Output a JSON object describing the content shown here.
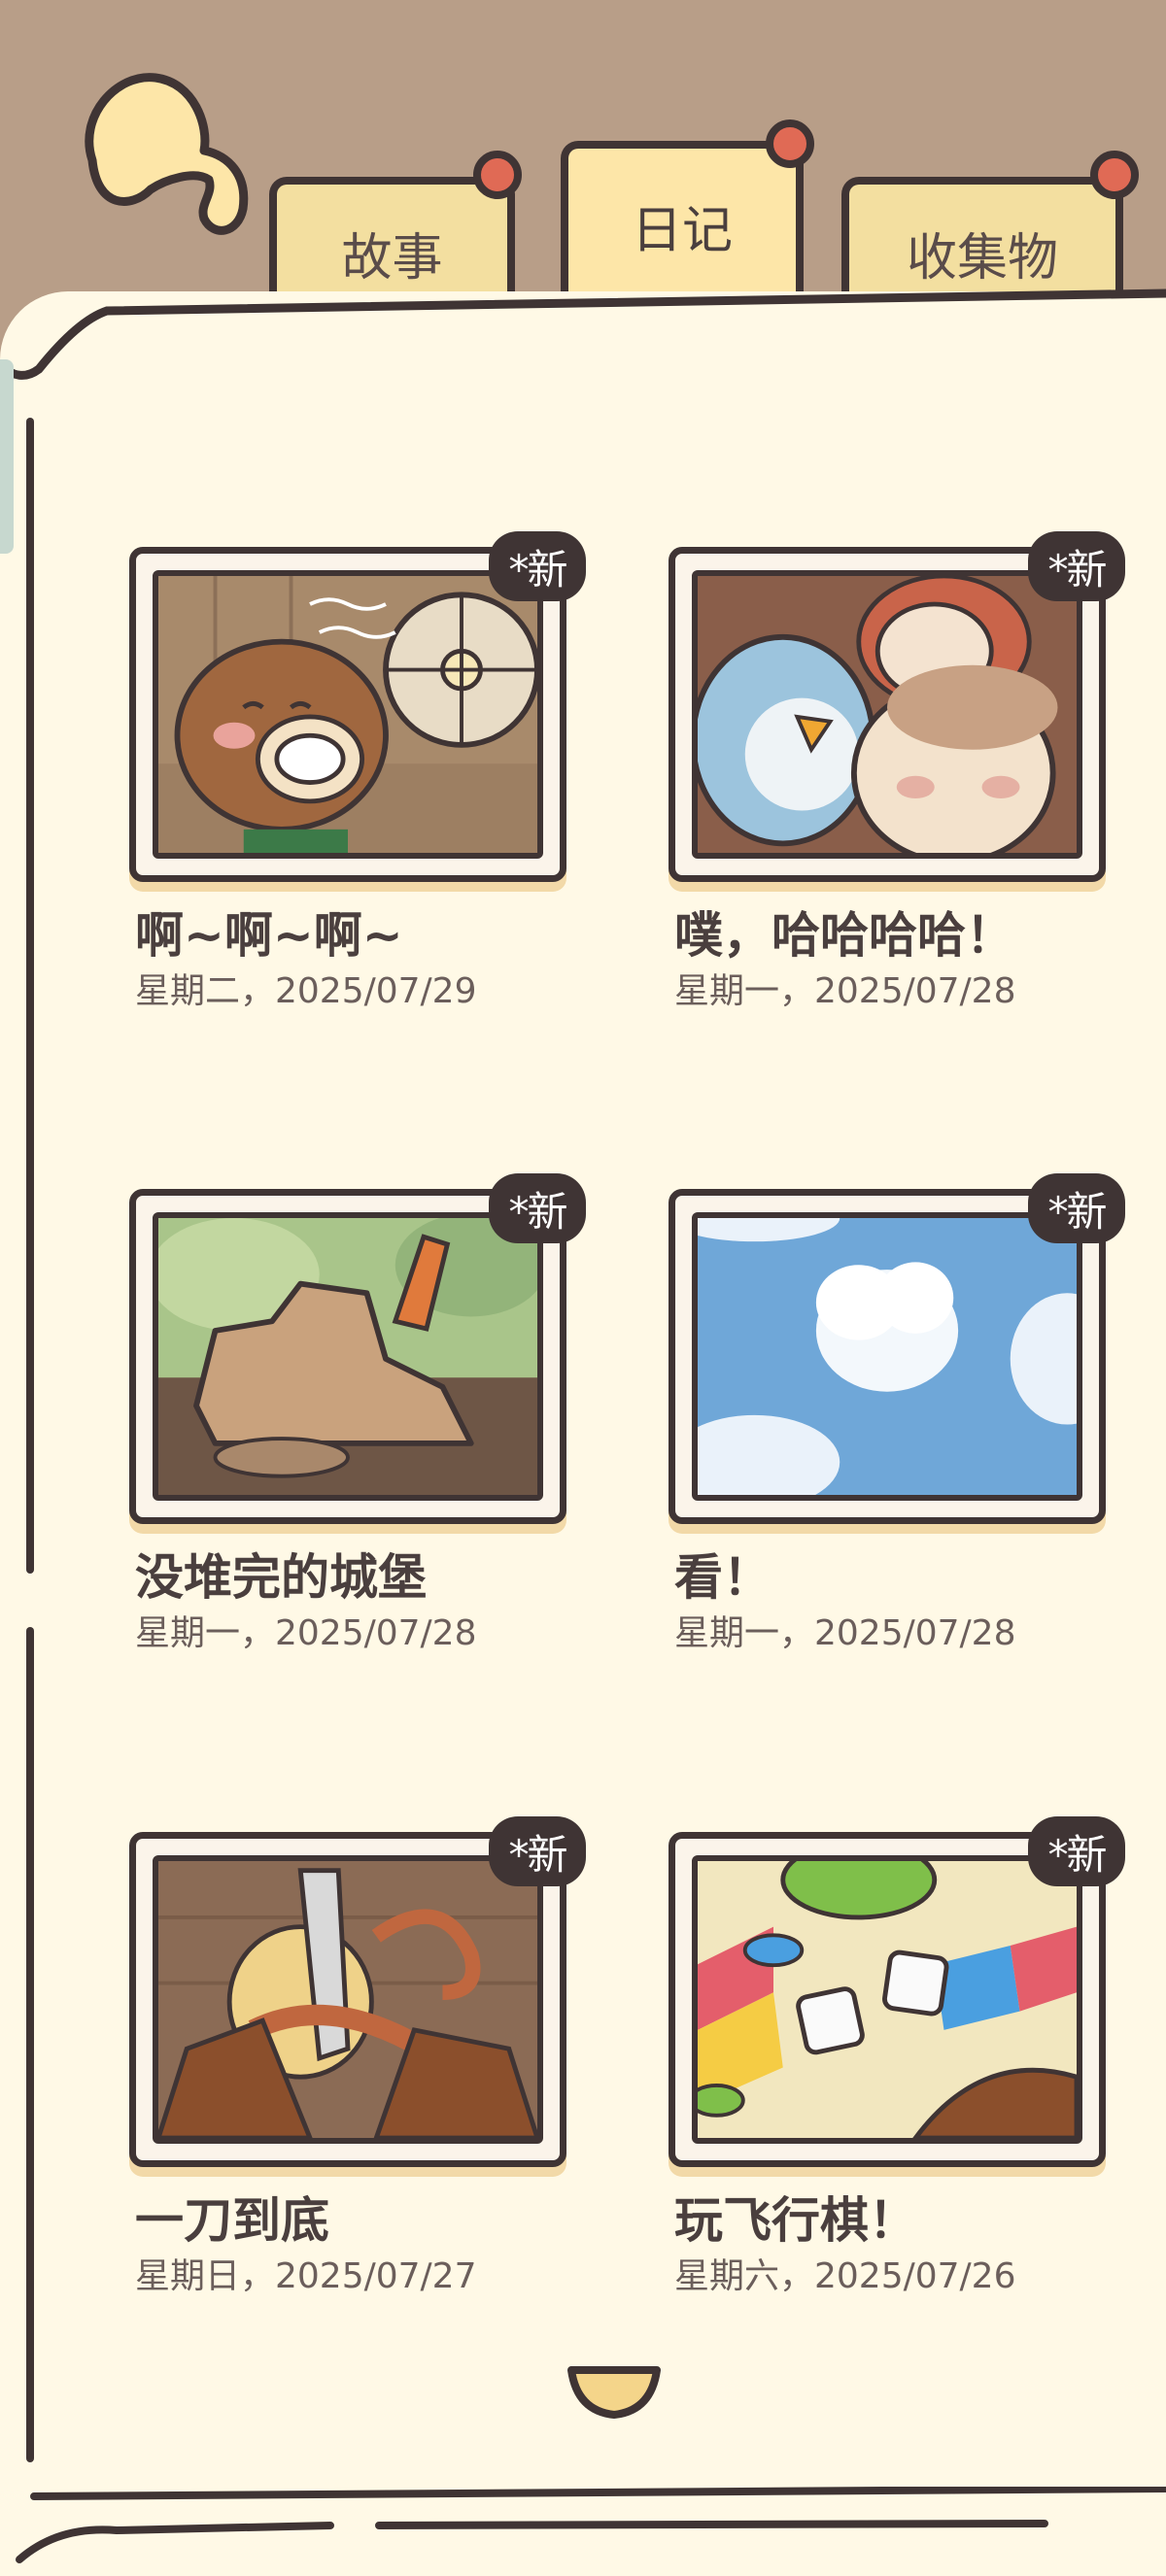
{
  "tabs": [
    {
      "label": "故事",
      "active": false
    },
    {
      "label": "日记",
      "active": true
    },
    {
      "label": "收集物",
      "active": false
    }
  ],
  "diary": [
    {
      "title": "啊~啊~啊~",
      "date": "星期二，2025/07/29",
      "badge": "*新",
      "image": "chipmunk-fan"
    },
    {
      "title": "噗，哈哈哈哈！",
      "date": "星期一，2025/07/28",
      "badge": "*新",
      "image": "friends-group"
    },
    {
      "title": "没堆完的城堡",
      "date": "星期一，2025/07/28",
      "badge": "*新",
      "image": "sand-castle"
    },
    {
      "title": "看！",
      "date": "星期一，2025/07/28",
      "badge": "*新",
      "image": "sky-cloud"
    },
    {
      "title": "一刀到底",
      "date": "星期日，2025/07/27",
      "badge": "*新",
      "image": "knife-peel"
    },
    {
      "title": "玩飞行棋！",
      "date": "星期六，2025/07/26",
      "badge": "*新",
      "image": "board-game-dice"
    }
  ],
  "icons": {
    "back": "back-arrow-icon",
    "more": "chevron-down-icon"
  },
  "colors": {
    "header_bg": "#b89e88",
    "panel_bg": "#fff9e6",
    "tab_bg": "#f3dfa0",
    "pin": "#e06a55",
    "outline": "#3f3434",
    "badge_bg": "#3f3434"
  }
}
